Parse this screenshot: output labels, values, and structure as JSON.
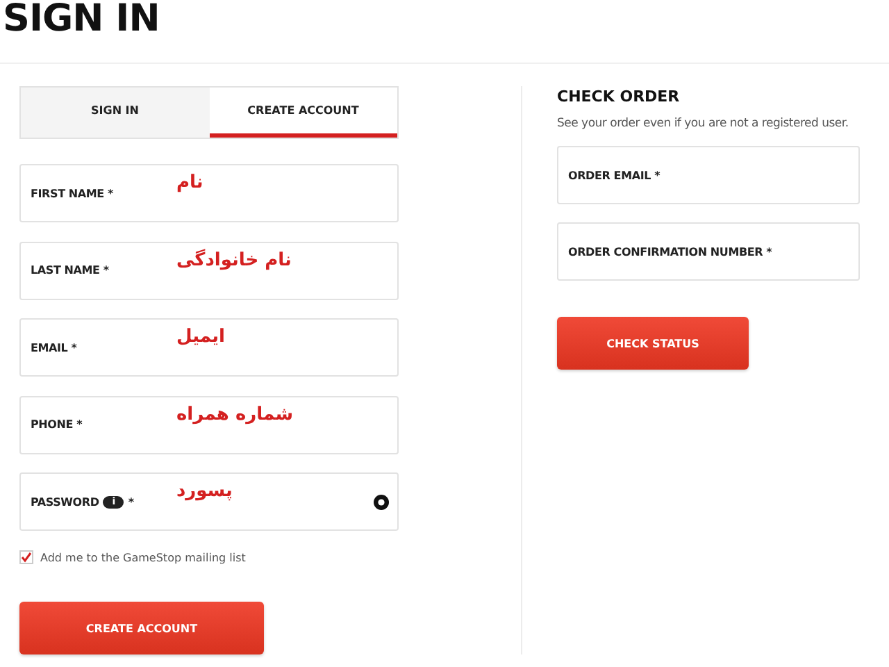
{
  "page_title": "SIGN IN",
  "tabs": [
    {
      "label": "SIGN IN",
      "selected": false
    },
    {
      "label": "CREATE ACCOUNT",
      "selected": true
    }
  ],
  "create_account": {
    "fields": [
      {
        "label": "FIRST NAME *",
        "annotation": "نام"
      },
      {
        "label": "LAST NAME *",
        "annotation": "نام خانوادگی"
      },
      {
        "label": "EMAIL *",
        "annotation": "ایمیل"
      },
      {
        "label": "PHONE *",
        "annotation": "شماره همراه"
      },
      {
        "label": "PASSWORD",
        "kind": "password",
        "badge": "i",
        "required_mark": "*",
        "annotation": "پسورد"
      }
    ],
    "mailing_list": {
      "label": "Add me to the GameStop mailing list",
      "checked": true
    },
    "button": "CREATE ACCOUNT"
  },
  "check_order": {
    "title": "CHECK ORDER",
    "subtitle": "See your order even if you are not a registered user.",
    "fields": [
      {
        "label": "ORDER EMAIL *"
      },
      {
        "label": "ORDER CONFIRMATION NUMBER *"
      }
    ],
    "button": "CHECK STATUS"
  }
}
